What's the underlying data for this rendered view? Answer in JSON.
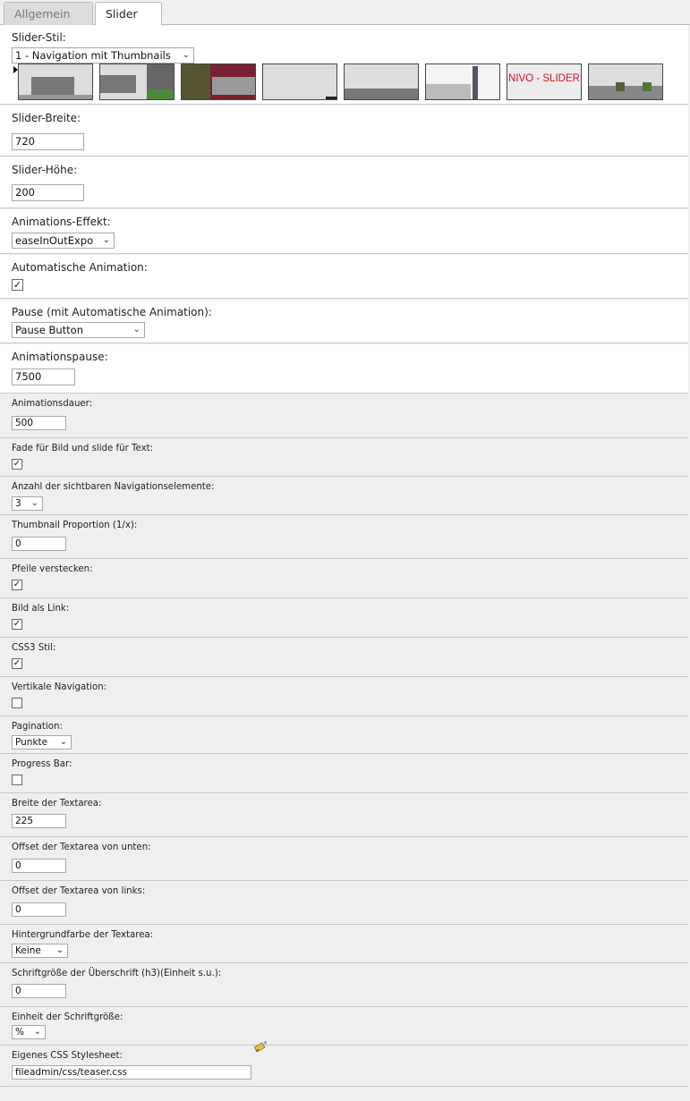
{
  "tabs": [
    {
      "label": "Allgemein",
      "active": false
    },
    {
      "label": "Slider",
      "active": true
    }
  ],
  "fields": {
    "slider_style": {
      "label": "Slider-Stil:",
      "value": "1 - Navigation mit Thumbnails",
      "thumb_text": "NIVO - SLIDER"
    },
    "slider_width": {
      "label": "Slider-Breite:",
      "value": "720"
    },
    "slider_height": {
      "label": "Slider-Höhe:",
      "value": "200"
    },
    "animation_effect": {
      "label": "Animations-Effekt:",
      "value": "easeInOutExpo"
    },
    "auto_animation": {
      "label": "Automatische Animation:",
      "checked": true
    },
    "pause": {
      "label": "Pause (mit Automatische Animation):",
      "value": "Pause Button"
    },
    "animation_pause": {
      "label": "Animationspause:",
      "value": "7500"
    },
    "animation_duration": {
      "label": "Animationsdauer:",
      "value": "500"
    },
    "fade_slide": {
      "label": "Fade für Bild und slide für Text:",
      "checked": true
    },
    "nav_count": {
      "label": "Anzahl der sichtbaren Navigationselemente:",
      "value": "3"
    },
    "thumb_proportion": {
      "label": "Thumbnail Proportion (1/x):",
      "value": "0"
    },
    "hide_arrows": {
      "label": "Pfeile verstecken:",
      "checked": true
    },
    "image_link": {
      "label": "Bild als Link:",
      "checked": true
    },
    "css3": {
      "label": "CSS3 Stil:",
      "checked": true
    },
    "vertical_nav": {
      "label": "Vertikale Navigation:",
      "checked": false
    },
    "pagination": {
      "label": "Pagination:",
      "value": "Punkte"
    },
    "progress_bar": {
      "label": "Progress Bar:",
      "checked": false
    },
    "textarea_width": {
      "label": "Breite der Textarea:",
      "value": "225"
    },
    "textarea_offset_bottom": {
      "label": "Offset der Textarea von unten:",
      "value": "0"
    },
    "textarea_offset_left": {
      "label": "Offset der Textarea von links:",
      "value": "0"
    },
    "textarea_bg": {
      "label": "Hintergrundfarbe der Textarea:",
      "value": "Keine"
    },
    "h3_font_size": {
      "label": "Schriftgröße der Überschrift (h3)(Einheit s.u.):",
      "value": "0"
    },
    "font_size_unit": {
      "label": "Einheit der Schriftgröße:",
      "value": "%"
    },
    "custom_css": {
      "label": "Eigenes CSS Stylesheet:",
      "value": "fileadmin/css/teaser.css"
    }
  },
  "icons": {
    "dropdown": "chevron-down-icon",
    "checkbox_checked": "check-icon",
    "link_wizard": "wizard-pencil-icon"
  }
}
